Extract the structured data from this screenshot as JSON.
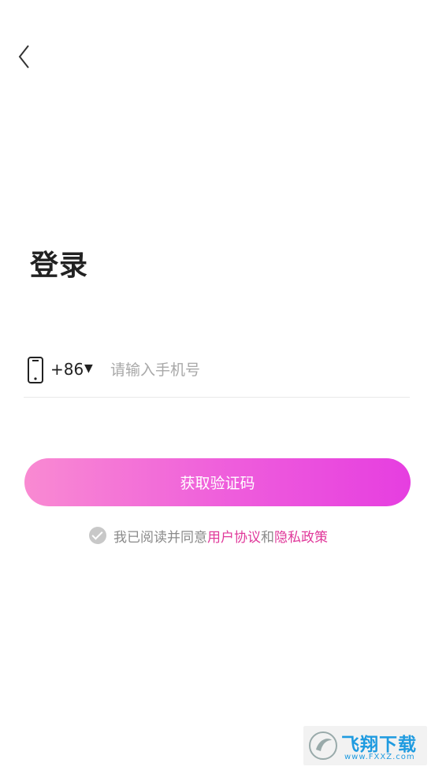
{
  "nav": {
    "back_icon": "back-chevron-icon"
  },
  "title": "登录",
  "phone": {
    "icon": "mobile-phone-icon",
    "country_code": "+86",
    "caret": "▼",
    "placeholder": "请输入手机号",
    "value": ""
  },
  "submit_button": {
    "label": "获取验证码"
  },
  "agreement": {
    "checked": true,
    "prefix": "我已阅读并同意",
    "user_agreement": "用户协议",
    "and": "和",
    "privacy_policy": "隐私政策"
  },
  "colors": {
    "accent_link": "#e0389a",
    "button_gradient_start": "#f98ad2",
    "button_gradient_end": "#e63ee0"
  },
  "watermark": {
    "title": "飞翔下载",
    "url": "www.FXXZ.com"
  }
}
